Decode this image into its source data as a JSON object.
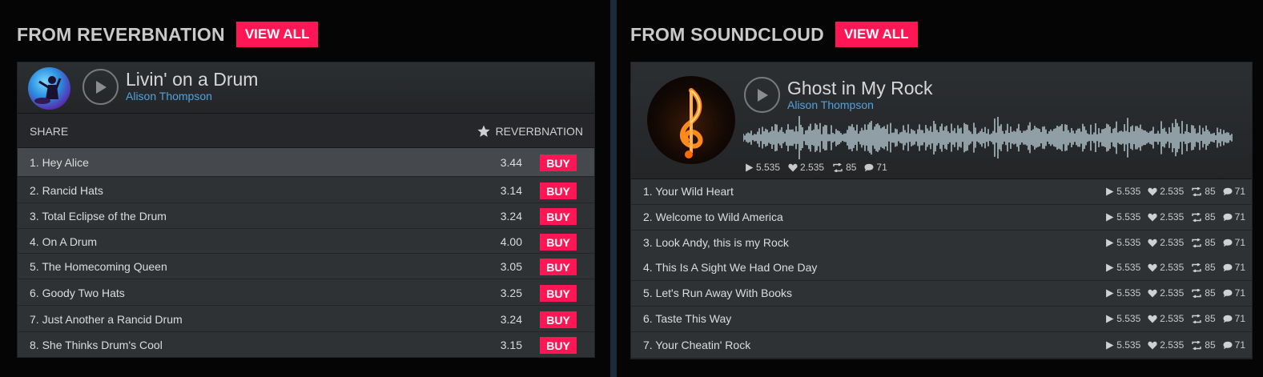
{
  "reverbnation": {
    "section_title": "FROM REVERBNATION",
    "view_all_label": "VIEW ALL",
    "player": {
      "title": "Livin' on a Drum",
      "artist": "Alison Thompson"
    },
    "share_label": "SHARE",
    "source_label": "REVERBNATION",
    "buy_label": "BUY",
    "tracks": [
      {
        "name": "1. Hey Alice",
        "price": "3.44"
      },
      {
        "name": "2. Rancid Hats",
        "price": "3.14"
      },
      {
        "name": "3. Total Eclipse of the Drum",
        "price": "3.24"
      },
      {
        "name": "4. On A Drum",
        "price": "4.00"
      },
      {
        "name": "5. The Homecoming Queen",
        "price": "3.05"
      },
      {
        "name": "6. Goody Two Hats",
        "price": "3.25"
      },
      {
        "name": "7. Just Another a Rancid Drum",
        "price": "3.24"
      },
      {
        "name": "8. She Thinks Drum's Cool",
        "price": "3.15"
      }
    ]
  },
  "soundcloud": {
    "section_title": "FROM SOUNDCLOUD",
    "view_all_label": "VIEW ALL",
    "player": {
      "title": "Ghost in My Rock",
      "artist": "Alison Thompson",
      "plays": "5.535",
      "likes": "2.535",
      "reposts": "85",
      "comments": "71"
    },
    "tracks": [
      {
        "name": "1. Your Wild Heart",
        "plays": "5.535",
        "likes": "2.535",
        "reposts": "85",
        "comments": "71"
      },
      {
        "name": "2. Welcome to Wild America",
        "plays": "5.535",
        "likes": "2.535",
        "reposts": "85",
        "comments": "71"
      },
      {
        "name": "3. Look Andy, this is my Rock",
        "plays": "5.535",
        "likes": "2.535",
        "reposts": "85",
        "comments": "71"
      },
      {
        "name": "4. This Is A Sight We Had One Day",
        "plays": "5.535",
        "likes": "2.535",
        "reposts": "85",
        "comments": "71"
      },
      {
        "name": "5. Let's Run Away  With Books",
        "plays": "5.535",
        "likes": "2.535",
        "reposts": "85",
        "comments": "71"
      },
      {
        "name": "6. Taste This Way",
        "plays": "5.535",
        "likes": "2.535",
        "reposts": "85",
        "comments": "71"
      },
      {
        "name": "7. Your Cheatin' Rock",
        "plays": "5.535",
        "likes": "2.535",
        "reposts": "85",
        "comments": "71"
      }
    ]
  },
  "colors": {
    "accent": "#ff1654",
    "artist_link": "#4fa3de",
    "waveform": "#d6ecf7"
  },
  "icons": {
    "play": "play-icon",
    "star": "star-icon",
    "heart": "heart-icon",
    "repost": "repost-icon",
    "comment": "comment-icon"
  }
}
